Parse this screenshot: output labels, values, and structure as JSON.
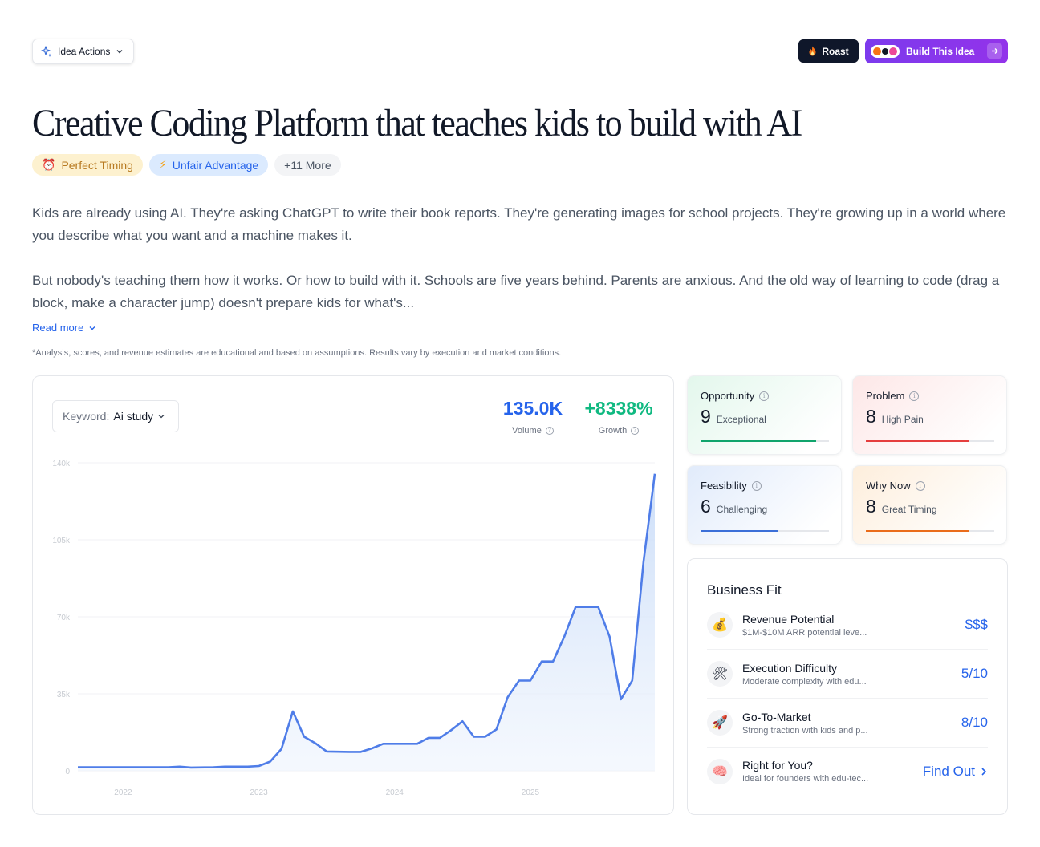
{
  "header": {
    "idea_actions_label": "Idea Actions",
    "roast_label": "Roast",
    "build_label": "Build This Idea"
  },
  "title": "Creative Coding Platform that teaches kids to build with AI",
  "tags": [
    {
      "label": "Perfect Timing",
      "icon": "alarm-clock-icon"
    },
    {
      "label": "Unfair Advantage",
      "icon": "lightning-icon"
    },
    {
      "label": "+11 More"
    }
  ],
  "description": {
    "paragraph1": "Kids are already using AI. They're asking ChatGPT to write their book reports. They're generating images for school projects. They're growing up in a world where you describe what you want and a machine makes it.",
    "paragraph2": "But nobody's teaching them how it works. Or how to build with it. Schools are five years behind. Parents are anxious. And the old way of learning to code (drag a block, make a character jump) doesn't prepare kids for what's...",
    "read_more": "Read more"
  },
  "disclaimer": "*Analysis, scores, and revenue estimates are educational and based on assumptions. Results vary by execution and market conditions.",
  "trend": {
    "keyword_label": "Keyword:",
    "keyword_value": "Ai study",
    "volume_value": "135.0K",
    "volume_label": "Volume",
    "growth_value": "+8338%",
    "growth_label": "Growth"
  },
  "chart_data": {
    "type": "area",
    "y_ticks": [
      "0",
      "35k",
      "70k",
      "105k",
      "140k"
    ],
    "x_ticks": [
      "2022",
      "2023",
      "2024",
      "2025"
    ],
    "ylim": [
      0,
      140000
    ],
    "x_range": [
      "2021-09",
      "2025-12"
    ],
    "line_color": "#4f7de8",
    "fill_color": "#dbe7fb",
    "series": [
      {
        "values": [
          [
            "2021-09",
            1600
          ],
          [
            "2022-01",
            1600
          ],
          [
            "2022-05",
            1600
          ],
          [
            "2022-06",
            1900
          ],
          [
            "2022-07",
            1500
          ],
          [
            "2022-09",
            1600
          ],
          [
            "2022-10",
            1900
          ],
          [
            "2022-12",
            1900
          ],
          [
            "2023-01",
            2200
          ],
          [
            "2023-02",
            4200
          ],
          [
            "2023-03",
            10000
          ],
          [
            "2023-04",
            27000
          ],
          [
            "2023-05",
            15500
          ],
          [
            "2023-06",
            12500
          ],
          [
            "2023-07",
            8800
          ],
          [
            "2023-09",
            8600
          ],
          [
            "2023-10",
            8600
          ],
          [
            "2023-11",
            10200
          ],
          [
            "2023-12",
            12300
          ],
          [
            "2024-02",
            12300
          ],
          [
            "2024-03",
            12300
          ],
          [
            "2024-04",
            15000
          ],
          [
            "2024-05",
            15000
          ],
          [
            "2024-06",
            18500
          ],
          [
            "2024-07",
            22500
          ],
          [
            "2024-08",
            15500
          ],
          [
            "2024-09",
            15500
          ],
          [
            "2024-10",
            18800
          ],
          [
            "2024-11",
            33500
          ],
          [
            "2024-12",
            41000
          ],
          [
            "2025-01",
            41000
          ],
          [
            "2025-02",
            49700
          ],
          [
            "2025-03",
            49700
          ],
          [
            "2025-04",
            61000
          ],
          [
            "2025-05",
            74500
          ],
          [
            "2025-07",
            74500
          ],
          [
            "2025-08",
            61000
          ],
          [
            "2025-09",
            32500
          ],
          [
            "2025-10",
            41000
          ],
          [
            "2025-11",
            95000
          ],
          [
            "2025-12",
            135000
          ],
          [
            "2026-01",
            135000
          ]
        ]
      }
    ]
  },
  "scores": [
    {
      "title": "Opportunity",
      "score": "9",
      "label": "Exceptional",
      "value": 0.9,
      "color": "#10a46c"
    },
    {
      "title": "Problem",
      "score": "8",
      "label": "High Pain",
      "value": 0.8,
      "color": "#e53e3e"
    },
    {
      "title": "Feasibility",
      "score": "6",
      "label": "Challenging",
      "value": 0.6,
      "color": "#3b6fd8"
    },
    {
      "title": "Why Now",
      "score": "8",
      "label": "Great Timing",
      "value": 0.8,
      "color": "#ea6c1a"
    }
  ],
  "business_fit": {
    "title": "Business Fit",
    "rows": [
      {
        "name": "Revenue Potential",
        "sub": "$1M-$10M ARR potential leve...",
        "value": "$$$",
        "icon": "money-bag-icon"
      },
      {
        "name": "Execution Difficulty",
        "sub": "Moderate complexity with edu...",
        "value": "5/10",
        "icon": "hammer-wrench-icon"
      },
      {
        "name": "Go-To-Market",
        "sub": "Strong traction with kids and p...",
        "value": "8/10",
        "icon": "rocket-icon"
      },
      {
        "name": "Right for You?",
        "sub": "Ideal for founders with edu-tec...",
        "value": "Find Out",
        "icon": "brain-icon"
      }
    ]
  }
}
